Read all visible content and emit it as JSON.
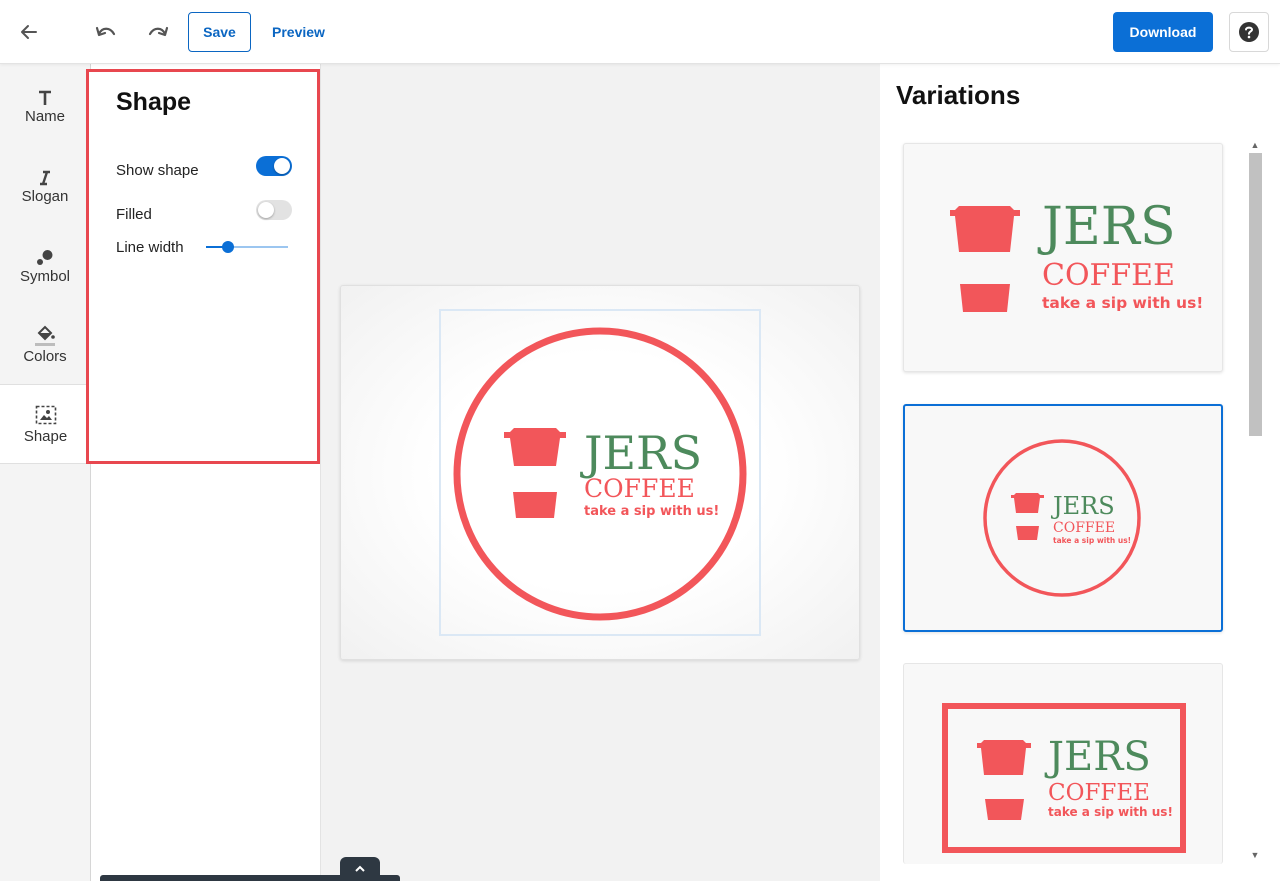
{
  "toolbar": {
    "back_icon": "arrow-left-icon",
    "undo_icon": "undo-icon",
    "redo_icon": "redo-icon",
    "save_label": "Save",
    "preview_label": "Preview",
    "download_label": "Download",
    "help_icon": "question-circle-icon",
    "accent_color": "#0b6fd6"
  },
  "sidebar": {
    "items": [
      {
        "label": "Name",
        "icon": "text-t-icon"
      },
      {
        "label": "Slogan",
        "icon": "italic-i-icon"
      },
      {
        "label": "Symbol",
        "icon": "shapes-icon"
      },
      {
        "label": "Colors",
        "icon": "paint-bucket-icon"
      },
      {
        "label": "Shape",
        "icon": "frame-image-icon"
      }
    ],
    "active": "Shape"
  },
  "panel": {
    "title": "Shape",
    "show_shape_label": "Show shape",
    "show_shape": true,
    "filled_label": "Filled",
    "filled": false,
    "line_width_label": "Line width",
    "line_width": 0.27
  },
  "logo": {
    "name": "JERS",
    "subname": "COFFEE",
    "slogan": "take a sip with us!",
    "symbol": "coffee-cup-icon",
    "primary_color": "#f2565a",
    "name_color": "#4d8a5c"
  },
  "variations": {
    "title": "Variations",
    "items": [
      {
        "shape": "none",
        "selected": false
      },
      {
        "shape": "circle",
        "selected": true
      },
      {
        "shape": "rectangle",
        "selected": false
      }
    ]
  }
}
